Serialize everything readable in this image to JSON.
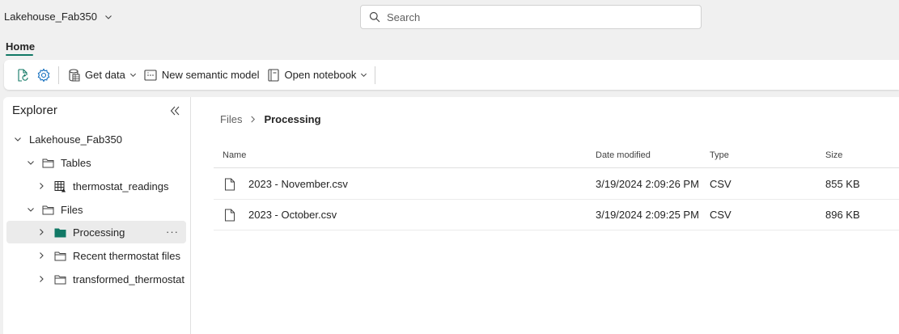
{
  "header": {
    "workspace_name": "Lakehouse_Fab350",
    "search_placeholder": "Search"
  },
  "tabs": {
    "home_label": "Home"
  },
  "toolbar": {
    "get_data_label": "Get data",
    "new_semantic_model_label": "New semantic model",
    "open_notebook_label": "Open notebook"
  },
  "explorer": {
    "title": "Explorer",
    "tree": {
      "root": "Lakehouse_Fab350",
      "tables": "Tables",
      "table_thermostat": "thermostat_readings",
      "files": "Files",
      "folder_processing": "Processing",
      "folder_recent": "Recent thermostat files",
      "folder_transformed": "transformed_thermostat",
      "more_label": "···"
    }
  },
  "main": {
    "breadcrumb": {
      "root": "Files",
      "current": "Processing"
    },
    "columns": {
      "name": "Name",
      "date": "Date modified",
      "type": "Type",
      "size": "Size"
    },
    "rows": [
      {
        "name": "2023 - November.csv",
        "date": "3/19/2024 2:09:26 PM",
        "type": "CSV",
        "size": "855 KB"
      },
      {
        "name": "2023 - October.csv",
        "date": "3/19/2024 2:09:25 PM",
        "type": "CSV",
        "size": "896 KB"
      }
    ]
  },
  "colors": {
    "accent": "#117865",
    "folder_selected": "#117865"
  }
}
